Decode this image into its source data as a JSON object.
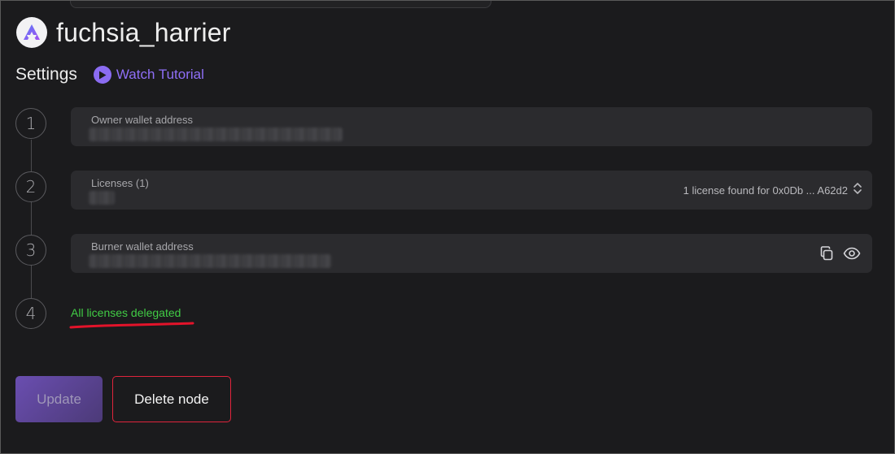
{
  "node": {
    "name": "fuchsia_harrier"
  },
  "settings": {
    "title": "Settings",
    "tutorial_label": "Watch Tutorial"
  },
  "steps": [
    {
      "number": "1",
      "label": "Owner wallet address"
    },
    {
      "number": "2",
      "label": "Licenses (1)",
      "status": "1 license found for 0x0Db ... A62d2"
    },
    {
      "number": "3",
      "label": "Burner wallet address"
    },
    {
      "number": "4",
      "status": "All licenses delegated"
    }
  ],
  "buttons": {
    "update_label": "Update",
    "delete_label": "Delete node"
  },
  "colors": {
    "accent_purple": "#8f6ff7",
    "success_green": "#41cc45",
    "danger_red": "#e0243c",
    "background": "#1b1b1d",
    "field_background": "#2b2b2e"
  },
  "icons": {
    "logo": "app-logo-icon",
    "play": "play-icon",
    "chevron": "chevron-up-down-icon",
    "copy": "copy-icon",
    "eye": "eye-icon"
  }
}
